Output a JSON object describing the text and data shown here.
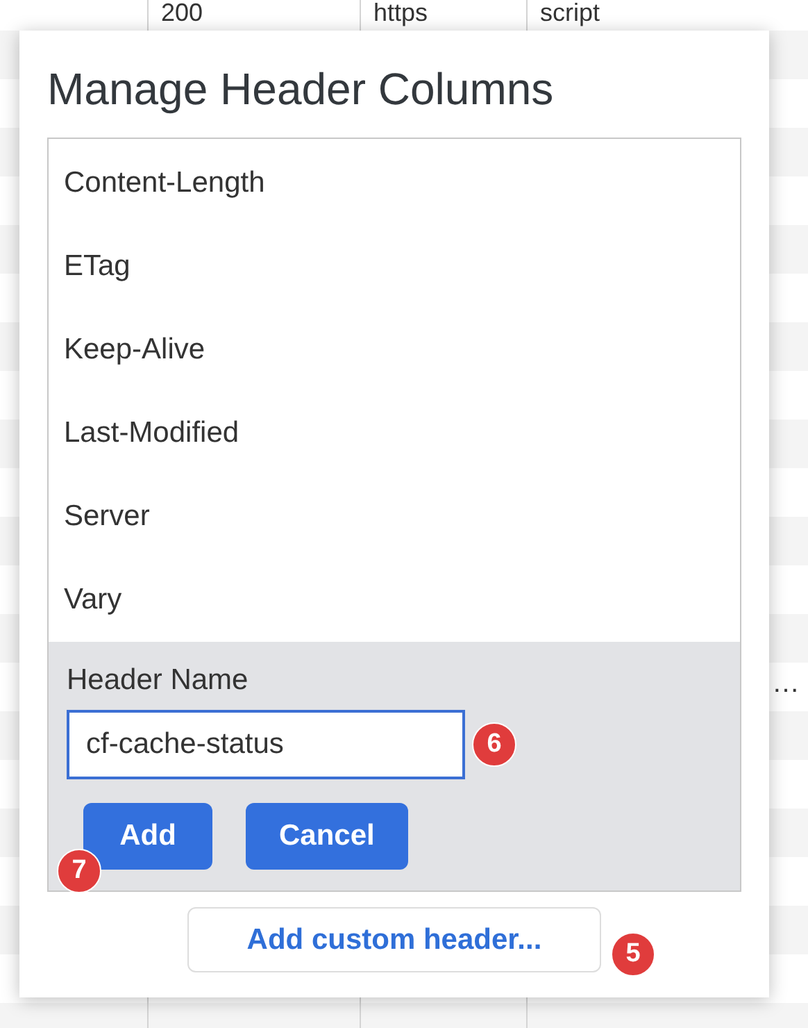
{
  "background_table": {
    "visible_cells": [
      "200",
      "https",
      "script"
    ],
    "truncated_cell": "…"
  },
  "dialog": {
    "title": "Manage Header Columns",
    "header_list": [
      "Content-Length",
      "ETag",
      "Keep-Alive",
      "Last-Modified",
      "Server",
      "Vary"
    ],
    "form": {
      "label": "Header Name",
      "value": "cf-cache-status",
      "badge": "6"
    },
    "buttons": [
      {
        "label": "Add",
        "badge": "7"
      },
      {
        "label": "Cancel"
      }
    ],
    "custom_header_button": {
      "label": "Add custom header...",
      "badge": "5"
    }
  }
}
